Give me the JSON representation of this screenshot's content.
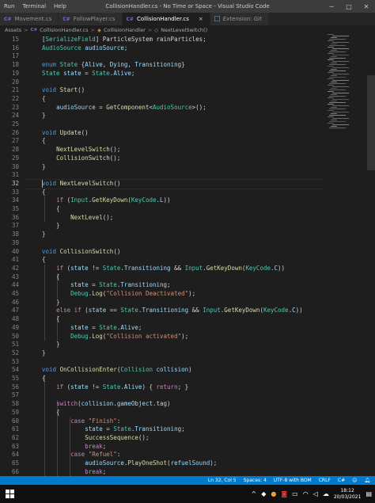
{
  "menu": {
    "items": [
      "Run",
      "Terminal",
      "Help"
    ]
  },
  "window_title": "CollisionHandler.cs - No Time or Space - Visual Studio Code",
  "window_controls": {
    "minimize": "─",
    "maximize": "□",
    "close": "✕"
  },
  "tabs": [
    {
      "icon": "C#",
      "label": "Movement.cs"
    },
    {
      "icon": "C#",
      "label": "FollowPlayer.cs"
    },
    {
      "icon": "C#",
      "label": "CollisionHandler.cs",
      "close": "×"
    },
    {
      "icon": "extension-icon",
      "label": "Extension: Git"
    }
  ],
  "breadcrumb": {
    "items": [
      "Assets",
      "C#",
      "CollisionHandler.cs",
      "CollisionHandler",
      "NextLevelSwitch()"
    ],
    "separator": ">"
  },
  "editor": {
    "line_numbers": [
      "15",
      "16",
      "17",
      "18",
      "19",
      "20",
      "21",
      "22",
      "23",
      "24",
      "25",
      "26",
      "27",
      "28",
      "29",
      "30",
      "31",
      "32",
      "33",
      "34",
      "35",
      "36",
      "37",
      "38",
      "39",
      "40",
      "41",
      "42",
      "43",
      "44",
      "45",
      "46",
      "47",
      "48",
      "49",
      "50",
      "51",
      "52",
      "53",
      "54",
      "55",
      "56",
      "57",
      "58",
      "59",
      "60",
      "61",
      "62",
      "63",
      "64",
      "65",
      "66"
    ],
    "current_line": "32",
    "lines": [
      [
        {
          "t": "[",
          "c": "txt"
        },
        {
          "t": "SerializeField",
          "c": "type"
        },
        {
          "t": "] ParticleSystem rainParticles;",
          "c": "txt"
        }
      ],
      [
        {
          "t": "AudioSource",
          "c": "type"
        },
        {
          "t": " ",
          "c": "txt"
        },
        {
          "t": "audioSource",
          "c": "var"
        },
        {
          "t": ";",
          "c": "txt"
        }
      ],
      [],
      [
        {
          "t": "enum",
          "c": "kw"
        },
        {
          "t": " ",
          "c": "txt"
        },
        {
          "t": "State",
          "c": "type"
        },
        {
          "t": " {",
          "c": "txt"
        },
        {
          "t": "Alive",
          "c": "var"
        },
        {
          "t": ", ",
          "c": "txt"
        },
        {
          "t": "Dying",
          "c": "var"
        },
        {
          "t": ", ",
          "c": "txt"
        },
        {
          "t": "Transitioning",
          "c": "var"
        },
        {
          "t": "}",
          "c": "txt"
        }
      ],
      [
        {
          "t": "State",
          "c": "type"
        },
        {
          "t": " ",
          "c": "txt"
        },
        {
          "t": "state",
          "c": "var"
        },
        {
          "t": " = ",
          "c": "txt"
        },
        {
          "t": "State",
          "c": "type"
        },
        {
          "t": ".",
          "c": "txt"
        },
        {
          "t": "Alive",
          "c": "var"
        },
        {
          "t": ";",
          "c": "txt"
        }
      ],
      [],
      [
        {
          "t": "void",
          "c": "kw"
        },
        {
          "t": " ",
          "c": "txt"
        },
        {
          "t": "Start",
          "c": "fn"
        },
        {
          "t": "()",
          "c": "txt"
        }
      ],
      [
        {
          "t": "{",
          "c": "txt"
        }
      ],
      [
        {
          "t": "    ",
          "c": "txt"
        },
        {
          "t": "audioSource",
          "c": "var"
        },
        {
          "t": " = ",
          "c": "txt"
        },
        {
          "t": "GetComponent",
          "c": "fn"
        },
        {
          "t": "<",
          "c": "txt"
        },
        {
          "t": "AudioSource",
          "c": "type"
        },
        {
          "t": ">();",
          "c": "txt"
        }
      ],
      [
        {
          "t": "}",
          "c": "txt"
        }
      ],
      [],
      [
        {
          "t": "void",
          "c": "kw"
        },
        {
          "t": " ",
          "c": "txt"
        },
        {
          "t": "Update",
          "c": "fn"
        },
        {
          "t": "()",
          "c": "txt"
        }
      ],
      [
        {
          "t": "{",
          "c": "txt"
        }
      ],
      [
        {
          "t": "    ",
          "c": "txt"
        },
        {
          "t": "NextLevelSwitch",
          "c": "fn"
        },
        {
          "t": "();",
          "c": "txt"
        }
      ],
      [
        {
          "t": "    ",
          "c": "txt"
        },
        {
          "t": "CollisionSwitch",
          "c": "fn"
        },
        {
          "t": "();",
          "c": "txt"
        }
      ],
      [
        {
          "t": "}",
          "c": "txt"
        }
      ],
      [],
      [
        {
          "t": "void",
          "c": "kw"
        },
        {
          "t": " ",
          "c": "txt"
        },
        {
          "t": "NextLevelSwitch",
          "c": "fn"
        },
        {
          "t": "()",
          "c": "txt"
        }
      ],
      [
        {
          "t": "{",
          "c": "txt"
        }
      ],
      [
        {
          "t": "    ",
          "c": "txt"
        },
        {
          "t": "if",
          "c": "ctl"
        },
        {
          "t": " (",
          "c": "txt"
        },
        {
          "t": "Input",
          "c": "type"
        },
        {
          "t": ".",
          "c": "txt"
        },
        {
          "t": "GetKeyDown",
          "c": "fn"
        },
        {
          "t": "(",
          "c": "txt"
        },
        {
          "t": "KeyCode",
          "c": "type"
        },
        {
          "t": ".",
          "c": "txt"
        },
        {
          "t": "L",
          "c": "var"
        },
        {
          "t": "))",
          "c": "txt"
        }
      ],
      [
        {
          "t": "    {",
          "c": "txt"
        }
      ],
      [
        {
          "t": "        ",
          "c": "txt"
        },
        {
          "t": "NextLevel",
          "c": "fn"
        },
        {
          "t": "();",
          "c": "txt"
        }
      ],
      [
        {
          "t": "    }",
          "c": "txt"
        }
      ],
      [
        {
          "t": "}",
          "c": "txt"
        }
      ],
      [],
      [
        {
          "t": "void",
          "c": "kw"
        },
        {
          "t": " ",
          "c": "txt"
        },
        {
          "t": "CollisionSwitch",
          "c": "fn"
        },
        {
          "t": "()",
          "c": "txt"
        }
      ],
      [
        {
          "t": "{",
          "c": "txt"
        }
      ],
      [
        {
          "t": "    ",
          "c": "txt"
        },
        {
          "t": "if",
          "c": "ctl"
        },
        {
          "t": " (",
          "c": "txt"
        },
        {
          "t": "state",
          "c": "var"
        },
        {
          "t": " != ",
          "c": "txt"
        },
        {
          "t": "State",
          "c": "type"
        },
        {
          "t": ".",
          "c": "txt"
        },
        {
          "t": "Transitioning",
          "c": "var"
        },
        {
          "t": " && ",
          "c": "txt"
        },
        {
          "t": "Input",
          "c": "type"
        },
        {
          "t": ".",
          "c": "txt"
        },
        {
          "t": "GetKeyDown",
          "c": "fn"
        },
        {
          "t": "(",
          "c": "txt"
        },
        {
          "t": "KeyCode",
          "c": "type"
        },
        {
          "t": ".",
          "c": "txt"
        },
        {
          "t": "C",
          "c": "var"
        },
        {
          "t": "))",
          "c": "txt"
        }
      ],
      [
        {
          "t": "    {",
          "c": "txt"
        }
      ],
      [
        {
          "t": "        ",
          "c": "txt"
        },
        {
          "t": "state",
          "c": "var"
        },
        {
          "t": " = ",
          "c": "txt"
        },
        {
          "t": "State",
          "c": "type"
        },
        {
          "t": ".",
          "c": "txt"
        },
        {
          "t": "Transitioning",
          "c": "var"
        },
        {
          "t": ";",
          "c": "txt"
        }
      ],
      [
        {
          "t": "        ",
          "c": "txt"
        },
        {
          "t": "Debug",
          "c": "type"
        },
        {
          "t": ".",
          "c": "txt"
        },
        {
          "t": "Log",
          "c": "fn"
        },
        {
          "t": "(",
          "c": "txt"
        },
        {
          "t": "\"Collision Deactivated\"",
          "c": "str"
        },
        {
          "t": ");",
          "c": "txt"
        }
      ],
      [
        {
          "t": "    }",
          "c": "txt"
        }
      ],
      [
        {
          "t": "    ",
          "c": "txt"
        },
        {
          "t": "else",
          "c": "ctl"
        },
        {
          "t": " ",
          "c": "txt"
        },
        {
          "t": "if",
          "c": "ctl"
        },
        {
          "t": " (",
          "c": "txt"
        },
        {
          "t": "state",
          "c": "var"
        },
        {
          "t": " == ",
          "c": "txt"
        },
        {
          "t": "State",
          "c": "type"
        },
        {
          "t": ".",
          "c": "txt"
        },
        {
          "t": "Transitioning",
          "c": "var"
        },
        {
          "t": " && ",
          "c": "txt"
        },
        {
          "t": "Input",
          "c": "type"
        },
        {
          "t": ".",
          "c": "txt"
        },
        {
          "t": "GetKeyDown",
          "c": "fn"
        },
        {
          "t": "(",
          "c": "txt"
        },
        {
          "t": "KeyCode",
          "c": "type"
        },
        {
          "t": ".",
          "c": "txt"
        },
        {
          "t": "C",
          "c": "var"
        },
        {
          "t": "))",
          "c": "txt"
        }
      ],
      [
        {
          "t": "    {",
          "c": "txt"
        }
      ],
      [
        {
          "t": "        ",
          "c": "txt"
        },
        {
          "t": "state",
          "c": "var"
        },
        {
          "t": " = ",
          "c": "txt"
        },
        {
          "t": "State",
          "c": "type"
        },
        {
          "t": ".",
          "c": "txt"
        },
        {
          "t": "Alive",
          "c": "var"
        },
        {
          "t": ";",
          "c": "txt"
        }
      ],
      [
        {
          "t": "        ",
          "c": "txt"
        },
        {
          "t": "Debug",
          "c": "type"
        },
        {
          "t": ".",
          "c": "txt"
        },
        {
          "t": "Log",
          "c": "fn"
        },
        {
          "t": "(",
          "c": "txt"
        },
        {
          "t": "\"Collision activated\"",
          "c": "str"
        },
        {
          "t": ");",
          "c": "txt"
        }
      ],
      [
        {
          "t": "    }",
          "c": "txt"
        }
      ],
      [
        {
          "t": "}",
          "c": "txt"
        }
      ],
      [],
      [
        {
          "t": "void",
          "c": "kw"
        },
        {
          "t": " ",
          "c": "txt"
        },
        {
          "t": "OnCollisionEnter",
          "c": "fn"
        },
        {
          "t": "(",
          "c": "txt"
        },
        {
          "t": "Collision",
          "c": "type"
        },
        {
          "t": " ",
          "c": "txt"
        },
        {
          "t": "collision",
          "c": "var"
        },
        {
          "t": ")",
          "c": "txt"
        }
      ],
      [
        {
          "t": "{",
          "c": "txt"
        }
      ],
      [
        {
          "t": "    ",
          "c": "txt"
        },
        {
          "t": "if",
          "c": "ctl"
        },
        {
          "t": " (",
          "c": "txt"
        },
        {
          "t": "state",
          "c": "var"
        },
        {
          "t": " != ",
          "c": "txt"
        },
        {
          "t": "State",
          "c": "type"
        },
        {
          "t": ".",
          "c": "txt"
        },
        {
          "t": "Alive",
          "c": "var"
        },
        {
          "t": ") { ",
          "c": "txt"
        },
        {
          "t": "return",
          "c": "ctl"
        },
        {
          "t": "; }",
          "c": "txt"
        }
      ],
      [],
      [
        {
          "t": "    ",
          "c": "txt"
        },
        {
          "t": "switch",
          "c": "ctl"
        },
        {
          "t": "(",
          "c": "txt"
        },
        {
          "t": "collision",
          "c": "var"
        },
        {
          "t": ".",
          "c": "txt"
        },
        {
          "t": "gameObject",
          "c": "var"
        },
        {
          "t": ".",
          "c": "txt"
        },
        {
          "t": "tag",
          "c": "var"
        },
        {
          "t": ")",
          "c": "txt"
        }
      ],
      [
        {
          "t": "    {",
          "c": "txt"
        }
      ],
      [
        {
          "t": "        ",
          "c": "txt"
        },
        {
          "t": "case",
          "c": "ctl"
        },
        {
          "t": " ",
          "c": "txt"
        },
        {
          "t": "\"Finish\"",
          "c": "str"
        },
        {
          "t": ":",
          "c": "txt"
        }
      ],
      [
        {
          "t": "            ",
          "c": "txt"
        },
        {
          "t": "state",
          "c": "var"
        },
        {
          "t": " = ",
          "c": "txt"
        },
        {
          "t": "State",
          "c": "type"
        },
        {
          "t": ".",
          "c": "txt"
        },
        {
          "t": "Transitioning",
          "c": "var"
        },
        {
          "t": ";",
          "c": "txt"
        }
      ],
      [
        {
          "t": "            ",
          "c": "txt"
        },
        {
          "t": "SuccessSequence",
          "c": "fn"
        },
        {
          "t": "();",
          "c": "txt"
        }
      ],
      [
        {
          "t": "            ",
          "c": "txt"
        },
        {
          "t": "break",
          "c": "ctl"
        },
        {
          "t": ";",
          "c": "txt"
        }
      ],
      [
        {
          "t": "        ",
          "c": "txt"
        },
        {
          "t": "case",
          "c": "ctl"
        },
        {
          "t": " ",
          "c": "txt"
        },
        {
          "t": "\"Refuel\"",
          "c": "str"
        },
        {
          "t": ":",
          "c": "txt"
        }
      ],
      [
        {
          "t": "            ",
          "c": "txt"
        },
        {
          "t": "audioSource",
          "c": "var"
        },
        {
          "t": ".",
          "c": "txt"
        },
        {
          "t": "PlayOneShot",
          "c": "fn"
        },
        {
          "t": "(",
          "c": "txt"
        },
        {
          "t": "refuelSound",
          "c": "var"
        },
        {
          "t": ");",
          "c": "txt"
        }
      ],
      [
        {
          "t": "            ",
          "c": "txt"
        },
        {
          "t": "break",
          "c": "ctl"
        },
        {
          "t": ";",
          "c": "txt"
        }
      ]
    ]
  },
  "statusbar": {
    "items": [
      "Ln 32, Col 5",
      "Spaces: 4",
      "UTF-8 with BOM",
      "CRLF",
      "C#"
    ]
  },
  "taskbar": {
    "time": "18:12",
    "date": "20/03/2021"
  },
  "colors": {
    "keyword": "#569cd6",
    "control": "#c586c0",
    "type": "#4ec9b0",
    "function": "#dcdcaa",
    "variable": "#9cdcfe",
    "string": "#ce9178",
    "text": "#d4d4d4",
    "statusbar": "#007acc"
  }
}
